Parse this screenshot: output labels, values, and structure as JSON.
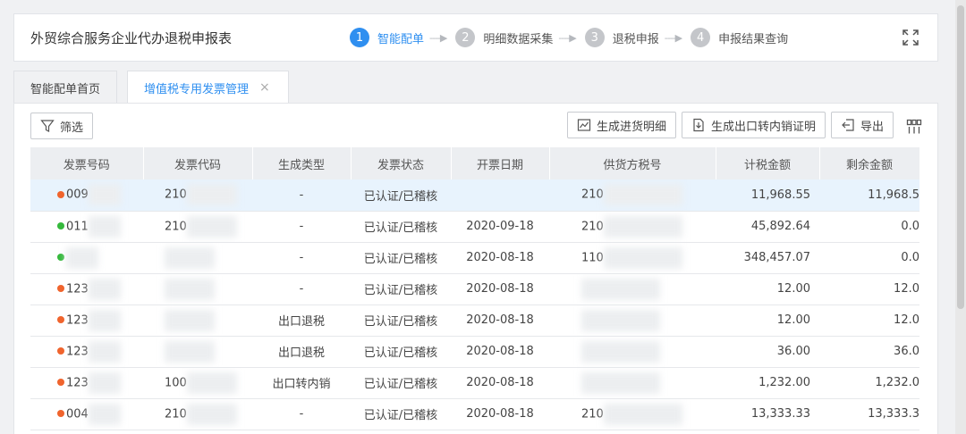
{
  "header": {
    "title": "外贸综合服务企业代办退税申报表",
    "steps": [
      {
        "num": "1",
        "label": "智能配单",
        "active": true
      },
      {
        "num": "2",
        "label": "明细数据采集",
        "active": false
      },
      {
        "num": "3",
        "label": "退税申报",
        "active": false
      },
      {
        "num": "4",
        "label": "申报结果查询",
        "active": false
      }
    ]
  },
  "tabs": [
    {
      "label": "智能配单首页",
      "active": false
    },
    {
      "label": "增值税专用发票管理",
      "active": true,
      "close": "×"
    }
  ],
  "toolbar": {
    "filter_label": "筛选",
    "purchase_detail_label": "生成进货明细",
    "export_domestic_label": "生成出口转内销证明",
    "export_label": "导出"
  },
  "table": {
    "columns": [
      "发票号码",
      "发票代码",
      "生成类型",
      "发票状态",
      "开票日期",
      "供货方税号",
      "计税金额",
      "剩余金额"
    ],
    "rows": [
      {
        "status_color": "red",
        "inv_no": "009",
        "inv_code": "210",
        "gen_type": "-",
        "inv_status": "已认证/已稽核",
        "date": "",
        "supplier": "210",
        "tax_amount": "11,968.55",
        "remaining": "11,968.5",
        "selected": true
      },
      {
        "status_color": "green",
        "inv_no": "011",
        "inv_code": "210",
        "gen_type": "-",
        "inv_status": "已认证/已稽核",
        "date": "2020-09-18",
        "supplier": "210",
        "tax_amount": "45,892.64",
        "remaining": "0.0",
        "selected": false
      },
      {
        "status_color": "green",
        "inv_no": "",
        "inv_code": "",
        "gen_type": "-",
        "inv_status": "已认证/已稽核",
        "date": "2020-08-18",
        "supplier": "110",
        "tax_amount": "348,457.07",
        "remaining": "0.0",
        "selected": false
      },
      {
        "status_color": "red",
        "inv_no": "123",
        "inv_code": "",
        "gen_type": "-",
        "inv_status": "已认证/已稽核",
        "date": "2020-08-18",
        "supplier": "",
        "tax_amount": "12.00",
        "remaining": "12.0",
        "selected": false
      },
      {
        "status_color": "red",
        "inv_no": "123",
        "inv_code": "",
        "gen_type": "出口退税",
        "inv_status": "已认证/已稽核",
        "date": "2020-08-18",
        "supplier": "",
        "tax_amount": "12.00",
        "remaining": "12.0",
        "selected": false
      },
      {
        "status_color": "red",
        "inv_no": "123",
        "inv_code": "",
        "gen_type": "出口退税",
        "inv_status": "已认证/已稽核",
        "date": "2020-08-18",
        "supplier": "",
        "tax_amount": "36.00",
        "remaining": "36.0",
        "selected": false
      },
      {
        "status_color": "red",
        "inv_no": "123",
        "inv_code": "100",
        "gen_type": "出口转内销",
        "inv_status": "已认证/已稽核",
        "date": "2020-08-18",
        "supplier": "",
        "tax_amount": "1,232.00",
        "remaining": "1,232.0",
        "selected": false
      },
      {
        "status_color": "red",
        "inv_no": "004",
        "inv_code": "210",
        "gen_type": "-",
        "inv_status": "已认证/已稽核",
        "date": "2020-08-18",
        "supplier": "210",
        "tax_amount": "13,333.33",
        "remaining": "13,333.3",
        "selected": false
      }
    ]
  },
  "colors": {
    "accent": "#2f8ff0",
    "status_red": "#f0642d",
    "status_green": "#35b93c"
  }
}
